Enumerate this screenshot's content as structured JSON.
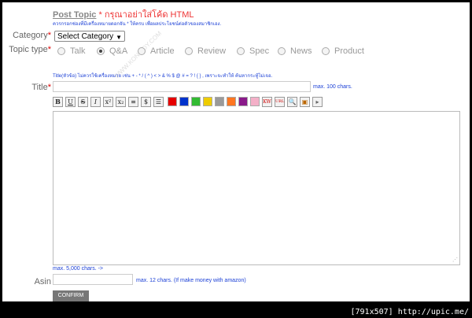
{
  "header": {
    "post_topic": "Post Topic",
    "warning": " * กรุณาอย่าใส่โค้ด HTML",
    "note": "ควรกรอกช่องที่มีเครื่องหมายดอกจัน * ให้ครบ เพื่อผลประโยชน์ต่อตัวของสมาชิกเอง."
  },
  "category": {
    "label": "Category",
    "required": "*",
    "selected": "Select Category"
  },
  "topic_type": {
    "label": "Topic type",
    "required": "*",
    "options": [
      {
        "label": "Talk",
        "checked": false
      },
      {
        "label": "Q&A",
        "checked": true
      },
      {
        "label": "Article",
        "checked": false
      },
      {
        "label": "Review",
        "checked": false
      },
      {
        "label": "Spec",
        "checked": false
      },
      {
        "label": "News",
        "checked": false
      },
      {
        "label": "Product",
        "checked": false
      }
    ]
  },
  "title_field": {
    "label": "Title",
    "required": "*",
    "note": "Title(หัวข้อ) ไม่ควรใช้เครื่องหมาย เช่น + - * / ( ^ ) < > & % $ @ # = ? ! { } , เพราะจะทำให้ ค้นหากระทู้ไม่เจอ.",
    "max": "max. 100 chars."
  },
  "toolbar": {
    "buttons": [
      "B",
      "U",
      "S",
      "I",
      "x²",
      "x₂",
      "≡",
      "$",
      "☰"
    ],
    "colors": [
      "#e60000",
      "#0033cc",
      "#33bb33",
      "#eecc00",
      "#9a9a9a",
      "#ff7722",
      "#8a1a8a",
      "#f4b0c8"
    ],
    "tools": [
      "KW",
      "URL",
      "🔍",
      "▣",
      "▸"
    ]
  },
  "body_field": {
    "max": "max. 5,000 chars. ->"
  },
  "asin": {
    "label": "Asin",
    "max": "max. 12 chars. (If make money with amazon)"
  },
  "confirm_label": "CONFIRM",
  "watermark": "WWW.KONINDY.COM",
  "footer": "[791x507] http://upic.me/"
}
